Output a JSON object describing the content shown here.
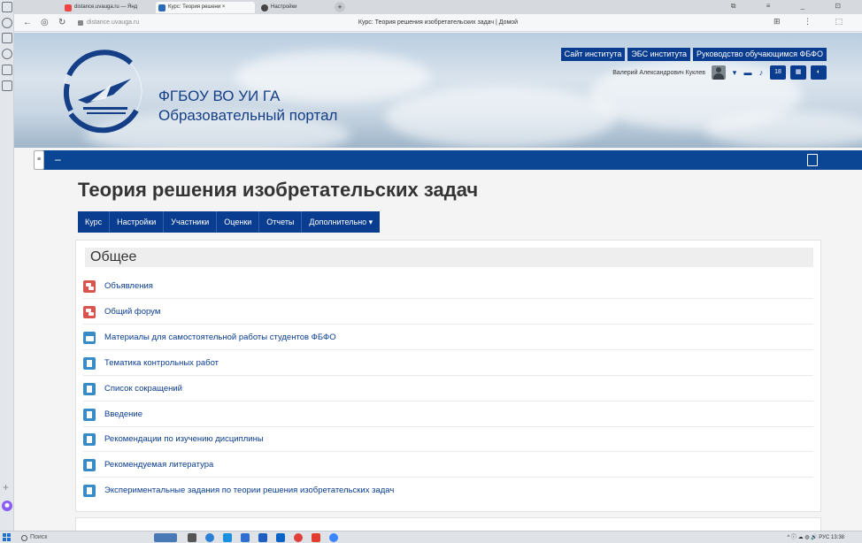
{
  "browser": {
    "tabs": [
      {
        "label": "distance.uvauga.ru — Янд",
        "active": false
      },
      {
        "label": "Курс: Теория решени ×",
        "active": true
      },
      {
        "label": "Настройки",
        "active": false
      }
    ],
    "url": "distance.uvauga.ru",
    "page_heading": "Курс: Теория решения изобретательских задач | Домой"
  },
  "header": {
    "org_name": "ФГБОУ ВО УИ ГА",
    "portal_name": "Образовательный портал",
    "top_links": [
      "Сайт института",
      "ЭБС института",
      "Руководство обучающимся ФБФО"
    ],
    "user_name": "Валерий Александрович Куклев"
  },
  "course": {
    "title": "Теория решения изобретательских задач",
    "tabs": [
      "Курс",
      "Настройки",
      "Участники",
      "Оценки",
      "Отчеты",
      "Дополнительно ▾"
    ]
  },
  "section": {
    "title": "Общее",
    "activities": [
      {
        "label": "Объявления",
        "icon": "forum-icon"
      },
      {
        "label": "Общий форум",
        "icon": "forum-icon"
      },
      {
        "label": "Материалы для самостоятельной работы студентов ФБФО",
        "icon": "folder-icon"
      },
      {
        "label": "Тематика контрольных работ",
        "icon": "page-icon"
      },
      {
        "label": "Список сокращений",
        "icon": "page-icon"
      },
      {
        "label": "Введение",
        "icon": "page-icon"
      },
      {
        "label": "Рекомендации по изучению дисциплины",
        "icon": "page-icon"
      },
      {
        "label": "Рекомендуемая литература",
        "icon": "page-icon"
      },
      {
        "label": "Экспериментальные задания по теории решения изобретательских задач",
        "icon": "page-icon"
      }
    ]
  },
  "taskbar": {
    "search_placeholder": "Поиск",
    "tray_text": "РУС",
    "time": "13:38"
  },
  "colors": {
    "brand_blue": "#0a3d8f",
    "forum_red": "#d9534f",
    "resource_blue": "#398bc5"
  }
}
